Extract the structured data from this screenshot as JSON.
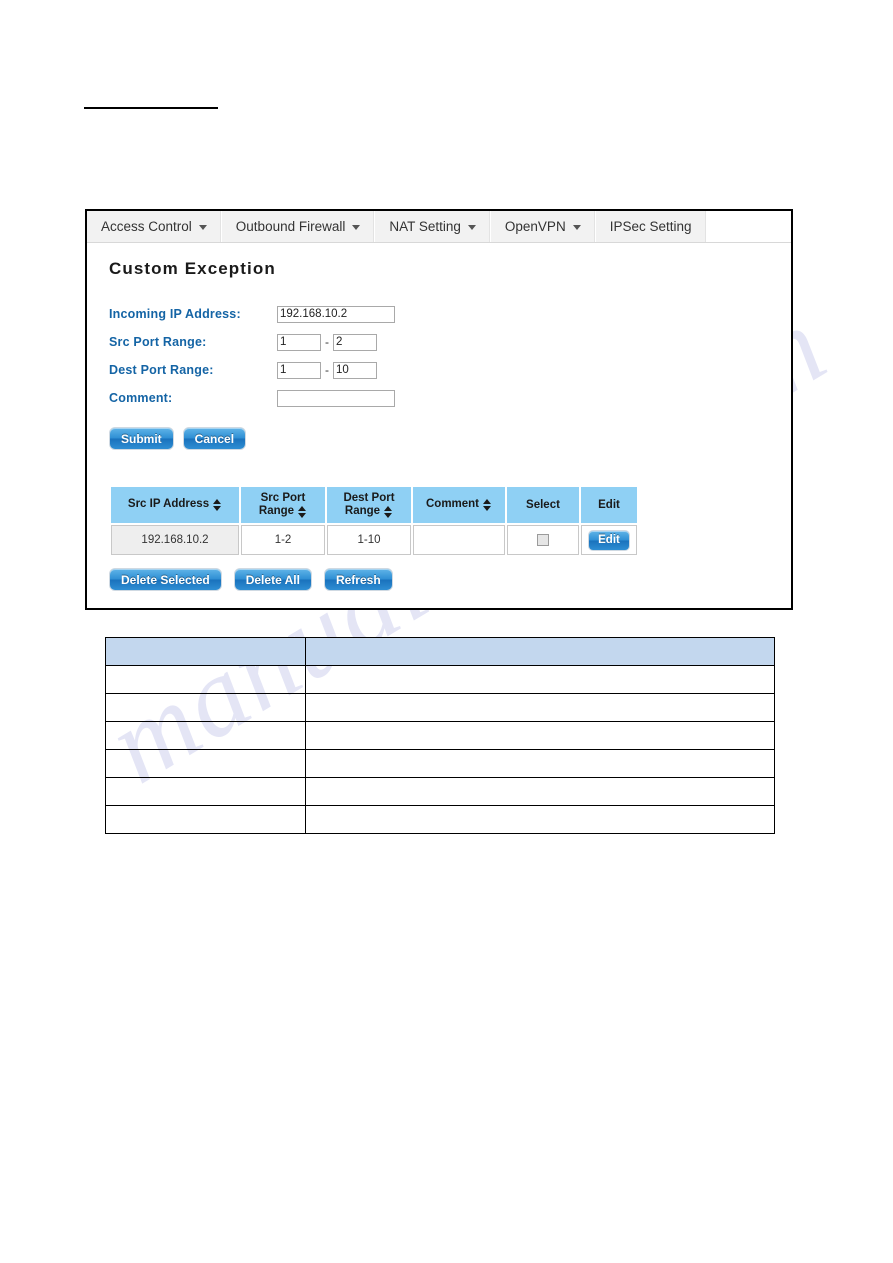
{
  "watermark": {
    "text": "manualshive.com"
  },
  "panel": {
    "tabs": [
      {
        "label": "Access Control",
        "has_caret": true,
        "name": "tab-access-control"
      },
      {
        "label": "Outbound Firewall",
        "has_caret": true,
        "name": "tab-outbound-firewall"
      },
      {
        "label": "NAT Setting",
        "has_caret": true,
        "name": "tab-nat-setting"
      },
      {
        "label": "OpenVPN",
        "has_caret": true,
        "name": "tab-openvpn"
      },
      {
        "label": "IPSec Setting",
        "has_caret": false,
        "name": "tab-ipsec-setting"
      }
    ],
    "title": "Custom Exception",
    "form": {
      "incoming_ip": {
        "label": "Incoming IP Address:",
        "value": "192.168.10.2",
        "placeholder": ""
      },
      "src_port_range": {
        "label": "Src Port Range:",
        "start": "1",
        "separator": "-",
        "end": "2"
      },
      "dest_port_range": {
        "label": "Dest Port Range:",
        "start": "1",
        "separator": "-",
        "end": "10"
      },
      "comment": {
        "label": "Comment:",
        "value": "",
        "placeholder": ""
      },
      "submit_label": "Submit",
      "cancel_label": "Cancel"
    },
    "table": {
      "columns": [
        {
          "label": "Src IP Address",
          "sortable": true
        },
        {
          "label": "Src Port Range",
          "sortable": true
        },
        {
          "label": "Dest Port Range",
          "sortable": true
        },
        {
          "label": "Comment",
          "sortable": true
        },
        {
          "label": "Select",
          "sortable": false
        },
        {
          "label": "Edit",
          "sortable": false
        }
      ],
      "rows": [
        {
          "src_ip": "192.168.10.2",
          "src_port_range": "1-2",
          "dest_port_range": "1-10",
          "comment": "",
          "selected": false,
          "edit_label": "Edit"
        }
      ],
      "actions": {
        "delete_selected_label": "Delete Selected",
        "delete_all_label": "Delete All",
        "refresh_label": "Refresh"
      }
    }
  },
  "doc_table": {
    "rows": [
      {
        "col1": "",
        "col2": ""
      },
      {
        "col1": "",
        "col2": ""
      },
      {
        "col1": "",
        "col2": ""
      },
      {
        "col1": "",
        "col2": ""
      },
      {
        "col1": "",
        "col2": ""
      },
      {
        "col1": "",
        "col2": ""
      },
      {
        "col1": "",
        "col2": ""
      }
    ]
  },
  "colors": {
    "tab_bg": "#f2f2f2",
    "label_blue": "#1464a5",
    "table_header_blue": "#8fd0f4",
    "doc_header_blue": "#c3d7ee",
    "button_blue": "#2f8fd4"
  }
}
